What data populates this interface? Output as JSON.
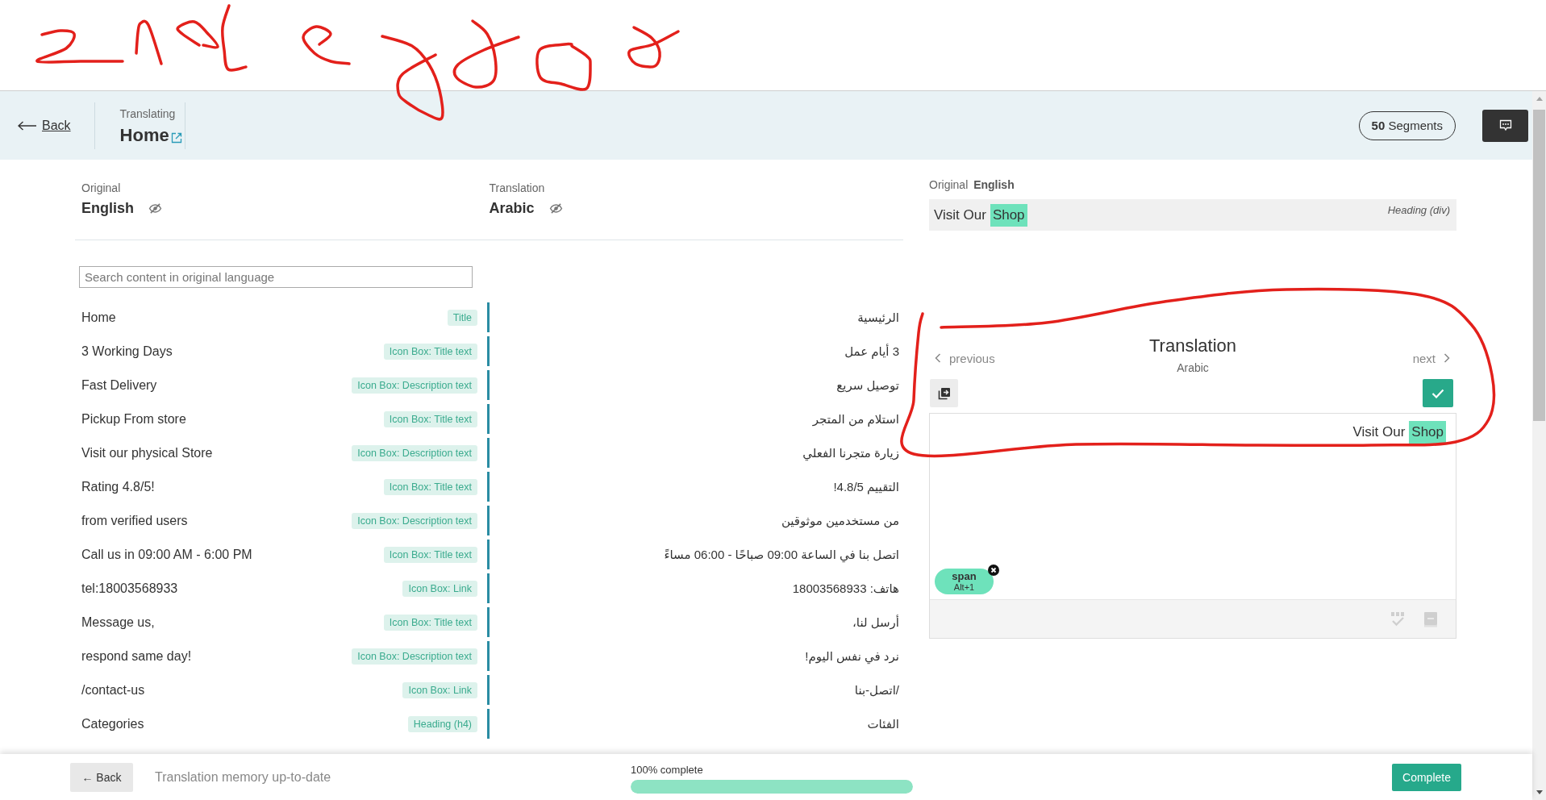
{
  "header": {
    "back": "Back",
    "caption": "Translating",
    "title": "Home",
    "segment_count": {
      "count": "50",
      "label": "Segments"
    }
  },
  "languages": [
    {
      "caption": "Original",
      "name": "English"
    },
    {
      "caption": "Translation",
      "name": "Arabic"
    }
  ],
  "search": {
    "placeholder": "Search content in original language"
  },
  "segments": [
    {
      "original": "Home",
      "type": "Title",
      "translation": "الرئيسية"
    },
    {
      "original": "3 Working Days",
      "type": "Icon Box: Title text",
      "translation": "3 أيام عمل"
    },
    {
      "original": "Fast Delivery",
      "type": "Icon Box: Description text",
      "translation": "توصيل سريع"
    },
    {
      "original": "Pickup From store",
      "type": "Icon Box: Title text",
      "translation": "استلام من المتجر"
    },
    {
      "original": "Visit our physical Store",
      "type": "Icon Box: Description text",
      "translation": "زيارة متجرنا الفعلي"
    },
    {
      "original": "Rating 4.8/5!",
      "type": "Icon Box: Title text",
      "translation": "التقييم 4.8/5!"
    },
    {
      "original": "from verified users",
      "type": "Icon Box: Description text",
      "translation": "من مستخدمين موثوقين"
    },
    {
      "original": "Call us in 09:00 AM - 6:00 PM",
      "type": "Icon Box: Title text",
      "translation": "اتصل بنا في الساعة 09:00 صباحًا - 06:00 مساءً"
    },
    {
      "original": "tel:18003568933",
      "type": "Icon Box: Link",
      "translation": "هاتف: 18003568933"
    },
    {
      "original": "Message us,",
      "type": "Icon Box: Title text",
      "translation": "أرسل لنا،"
    },
    {
      "original": "respond same day!",
      "type": "Icon Box: Description text",
      "translation": "نرد في نفس اليوم!"
    },
    {
      "original": "/contact-us",
      "type": "Icon Box: Link",
      "translation": "/اتصل-بنا"
    },
    {
      "original": "Categories",
      "type": "Heading (h4)",
      "translation": "الفئات"
    }
  ],
  "original_panel": {
    "caption": "Original",
    "language": "English",
    "parts": [
      {
        "text": "Visit Our",
        "tagged": false
      },
      {
        "text": "Shop",
        "tagged": true
      }
    ],
    "element_type": "Heading (div)"
  },
  "translation_panel": {
    "previous": "previous",
    "title": "Translation",
    "language": "Arabic",
    "next": "next",
    "parts": [
      {
        "text": "Visit Our",
        "tagged": false
      },
      {
        "text": "Shop",
        "tagged": true
      }
    ],
    "tags": [
      {
        "name": "span",
        "shortcut": "Alt+1"
      }
    ]
  },
  "footer": {
    "back": "← Back",
    "status": "Translation memory up-to-date",
    "progress": {
      "label": "100% complete",
      "level": 1
    },
    "complete": "Complete"
  }
}
